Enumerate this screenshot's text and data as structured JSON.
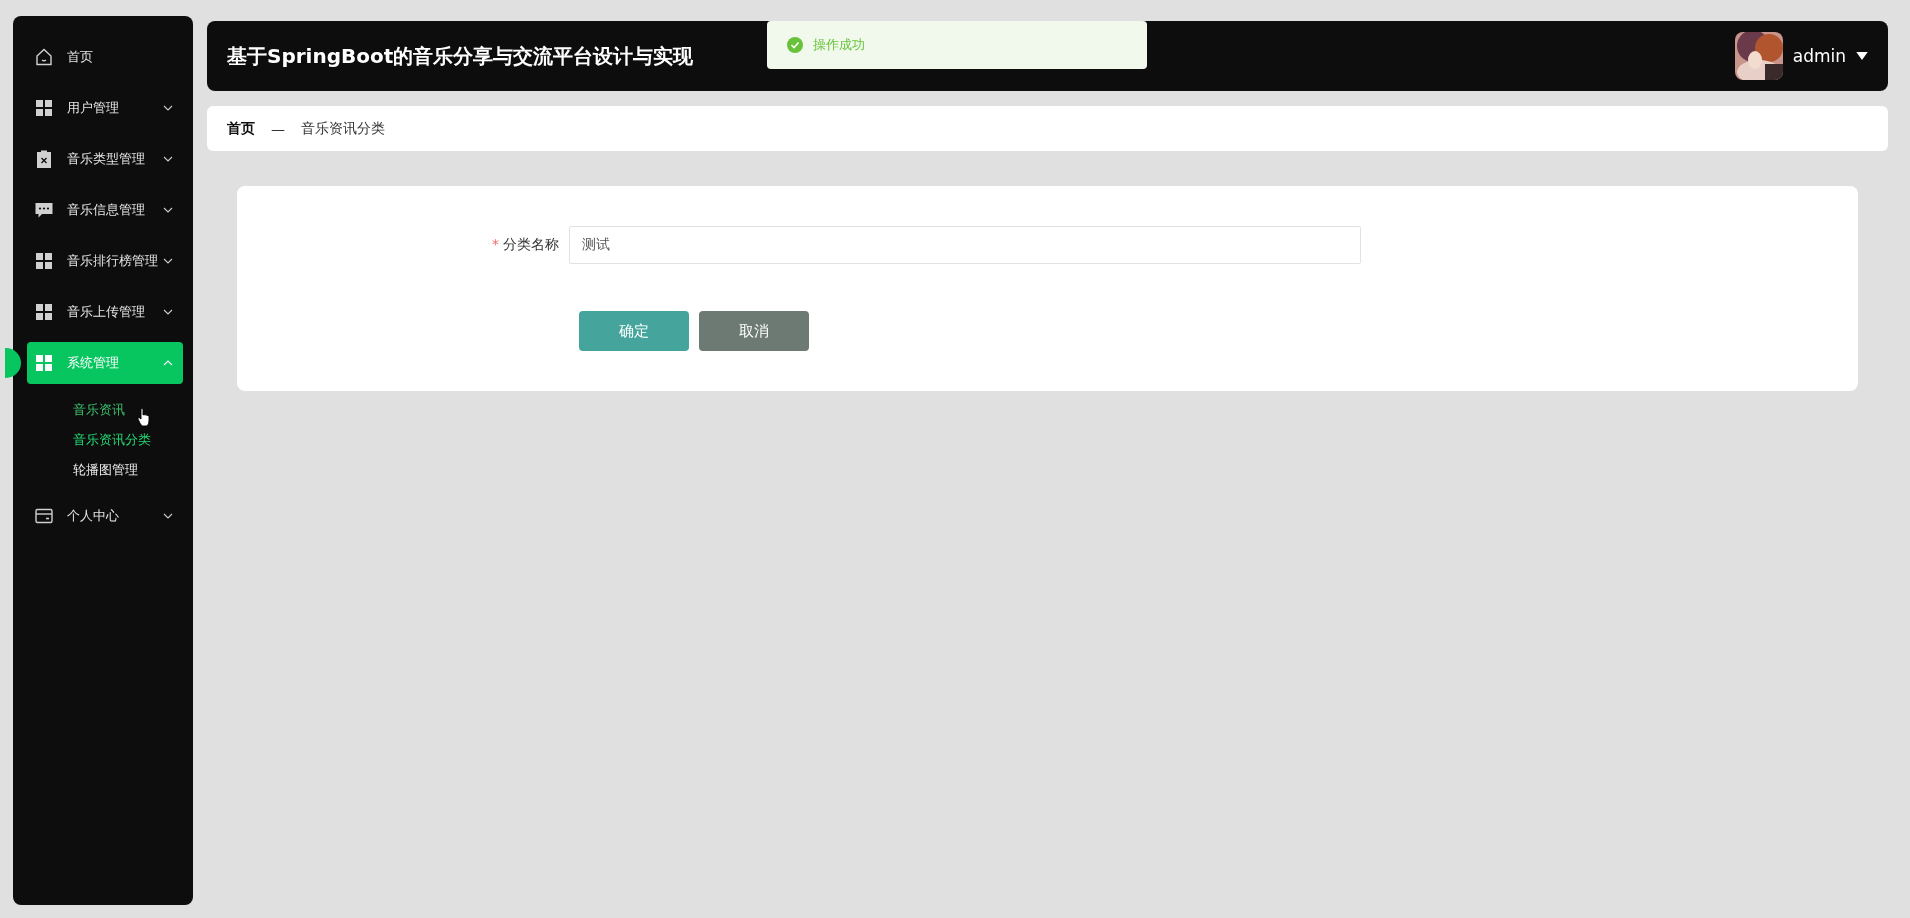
{
  "sidebar": {
    "items": [
      {
        "label": "首页",
        "selected": false
      },
      {
        "label": "用户管理",
        "expanded": false,
        "selected": false
      },
      {
        "label": "音乐类型管理",
        "expanded": false,
        "selected": false
      },
      {
        "label": "音乐信息管理",
        "expanded": false,
        "selected": false
      },
      {
        "label": "音乐排行榜管理",
        "expanded": false,
        "selected": false
      },
      {
        "label": "音乐上传管理",
        "expanded": false,
        "selected": false
      },
      {
        "label": "系统管理",
        "expanded": true,
        "selected": true,
        "children": [
          {
            "label": "音乐资讯",
            "selected": false,
            "hovered": true
          },
          {
            "label": "音乐资讯分类",
            "selected": true,
            "hovered": false
          },
          {
            "label": "轮播图管理",
            "selected": false,
            "hovered": false
          }
        ]
      },
      {
        "label": "个人中心",
        "expanded": false,
        "selected": false
      }
    ]
  },
  "header": {
    "title": "基于SpringBoot的音乐分享与交流平台设计与实现",
    "user": "admin"
  },
  "toast": {
    "message": "操作成功"
  },
  "breadcrumb": [
    "首页",
    "—",
    "音乐资讯分类"
  ],
  "form": {
    "fields": [
      {
        "label": "分类名称",
        "required_mark": "*",
        "value": "测试"
      }
    ],
    "buttons": [
      {
        "label": "确定",
        "kind": "primary"
      },
      {
        "label": "取消",
        "kind": "secondary"
      }
    ]
  }
}
